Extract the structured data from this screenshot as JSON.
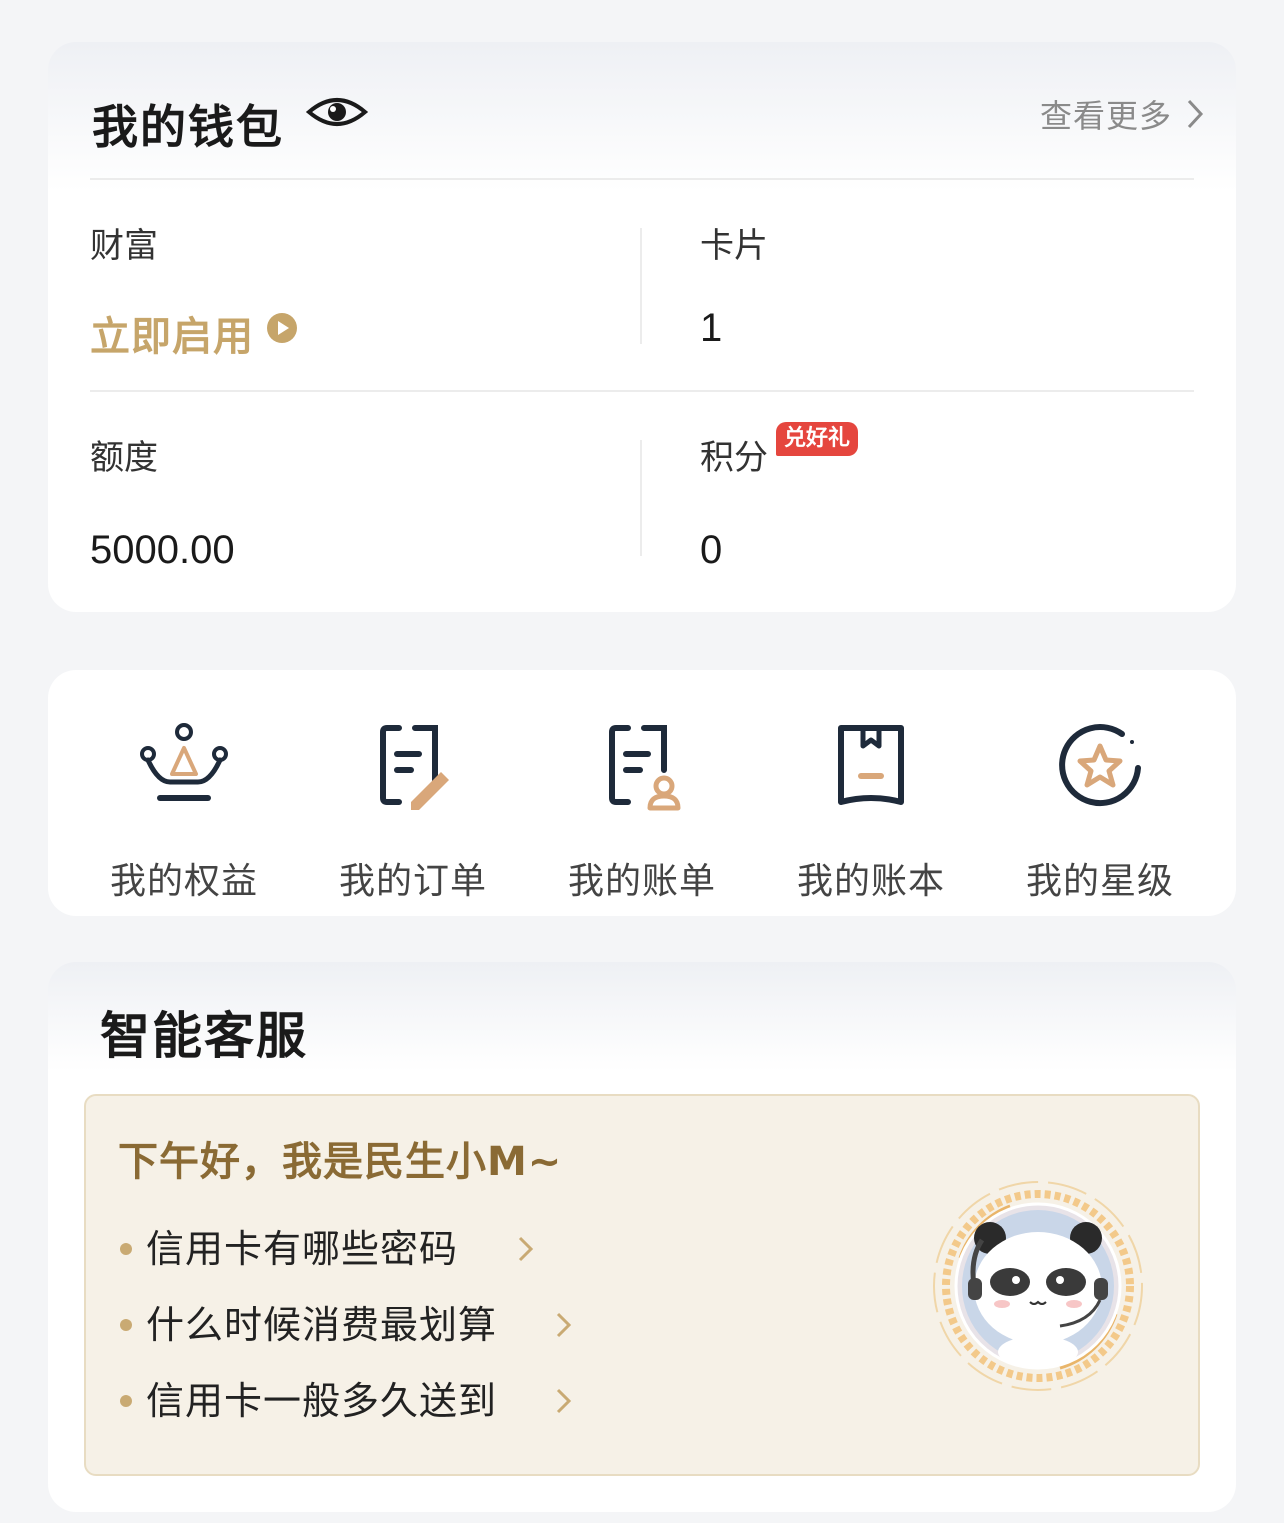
{
  "wallet": {
    "title": "我的钱包",
    "more": "查看更多",
    "wealth_label": "财富",
    "wealth_action": "立即启用",
    "cards_label": "卡片",
    "cards_value": "1",
    "limit_label": "额度",
    "limit_value": "5000.00",
    "points_label": "积分",
    "points_badge": "兑好礼",
    "points_value": "0"
  },
  "shortcuts": [
    {
      "label": "我的权益",
      "icon": "crown-icon"
    },
    {
      "label": "我的订单",
      "icon": "order-edit-icon"
    },
    {
      "label": "我的账单",
      "icon": "bill-person-icon"
    },
    {
      "label": "我的账本",
      "icon": "ledger-icon"
    },
    {
      "label": "我的星级",
      "icon": "star-level-icon"
    }
  ],
  "service": {
    "title": "智能客服",
    "greeting": "下午好，我是民生小M~",
    "questions": [
      "信用卡有哪些密码",
      "什么时候消费最划算",
      "信用卡一般多久送到"
    ]
  },
  "colors": {
    "gold": "#c6a56a",
    "dark_navy": "#1e2a3a",
    "badge_red": "#e5463e",
    "service_bg": "#f6f1e7"
  }
}
